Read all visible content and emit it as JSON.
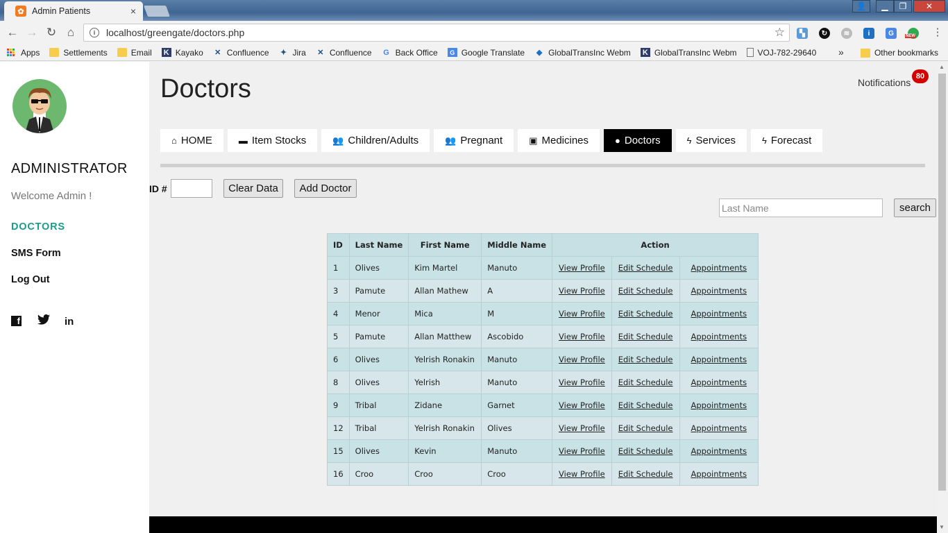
{
  "browser": {
    "tab_title": "Admin Patients",
    "tab_close": "×",
    "url": "localhost/greengate/doctors.php",
    "ext_new_badge": "NEW",
    "bookmarks": [
      {
        "label": "Apps",
        "icon": "apps-icon"
      },
      {
        "label": "Settlements",
        "icon": "folder-icon"
      },
      {
        "label": "Email",
        "icon": "folder-icon"
      },
      {
        "label": "Kayako",
        "icon": "kayako-icon"
      },
      {
        "label": "Confluence",
        "icon": "confluence-icon"
      },
      {
        "label": "Jira",
        "icon": "jira-icon"
      },
      {
        "label": "Confluence",
        "icon": "confluence-icon"
      },
      {
        "label": "Back Office",
        "icon": "google-icon"
      },
      {
        "label": "Google Translate",
        "icon": "translate-icon"
      },
      {
        "label": "GlobalTransInc Webm",
        "icon": "globe-icon"
      },
      {
        "label": "GlobalTransInc Webm",
        "icon": "kayako-icon"
      },
      {
        "label": "VOJ-782-29640",
        "icon": "page-icon"
      }
    ],
    "more_bookmarks": "»",
    "other_bookmarks": "Other bookmarks"
  },
  "sidebar": {
    "role": "ADMINISTRATOR",
    "welcome": "Welcome Admin !",
    "links": [
      "DOCTORS",
      "SMS Form",
      "Log Out"
    ],
    "social": {
      "facebook": "f",
      "twitter": "🐦",
      "linkedin": "in"
    }
  },
  "header": {
    "title": "Doctors",
    "notifications_label": "Notifications",
    "notifications_count": "80"
  },
  "nav_tabs": [
    {
      "label": "HOME",
      "icon": "⌂",
      "active": false
    },
    {
      "label": "Item Stocks",
      "icon": "▬",
      "active": false
    },
    {
      "label": "Children/Adults",
      "icon": "👥",
      "active": false
    },
    {
      "label": "Pregnant",
      "icon": "👥",
      "active": false
    },
    {
      "label": "Medicines",
      "icon": "▣",
      "active": false
    },
    {
      "label": "Doctors",
      "icon": "●",
      "active": true
    },
    {
      "label": "Services",
      "icon": "ϟ",
      "active": false
    },
    {
      "label": "Forecast",
      "icon": "ϟ",
      "active": false
    }
  ],
  "form": {
    "id_label": "ID #",
    "id_value": "",
    "clear_button": "Clear Data",
    "add_button": "Add Doctor",
    "search_placeholder": "Last Name",
    "search_value": "",
    "search_button": "search"
  },
  "table": {
    "headers": [
      "ID",
      "Last Name",
      "First Name",
      "Middle Name",
      "Action"
    ],
    "action_links": [
      "View Profile",
      "Edit Schedule",
      "Appointments"
    ],
    "rows": [
      [
        "1",
        "Olives",
        "Kim Martel",
        "Manuto"
      ],
      [
        "3",
        "Pamute",
        "Allan Mathew",
        "A"
      ],
      [
        "4",
        "Menor",
        "Mica",
        "M"
      ],
      [
        "5",
        "Pamute",
        "Allan Matthew",
        "Ascobido"
      ],
      [
        "6",
        "Olives",
        "Yelrish Ronakin",
        "Manuto"
      ],
      [
        "8",
        "Olives",
        "Yelrish",
        "Manuto"
      ],
      [
        "9",
        "Tribal",
        "Zidane",
        "Garnet"
      ],
      [
        "12",
        "Tribal",
        "Yelrish Ronakin",
        "Olives"
      ],
      [
        "15",
        "Olives",
        "Kevin",
        "Manuto"
      ],
      [
        "16",
        "Croo",
        "Croo",
        "Croo"
      ]
    ]
  },
  "colors": {
    "accent": "#1a9c8c",
    "table_header": "#c6e0e4",
    "badge": "#d40000"
  }
}
